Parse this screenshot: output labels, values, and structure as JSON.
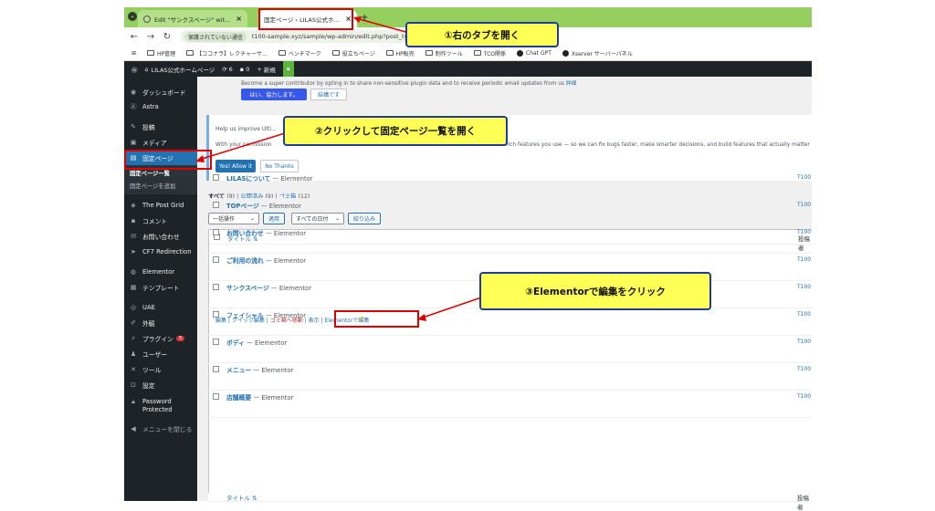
{
  "browser": {
    "tabs": [
      {
        "label": "Edit \"サンクスページ\" with Elemen",
        "active": false
      },
      {
        "label": "固定ページ ‹ LILAS公式ホームページ",
        "active": true
      }
    ],
    "url": "t100-sample.xyz/sample/wp-admin/edit.php?post_type",
    "security_label": "保護されていない通信",
    "bookmarks": [
      "HP管理",
      "【ココナラ】レクチャーサ...",
      "ベンチマーク",
      "役立ちページ",
      "HP販売",
      "制作ツール",
      "TCO関係",
      "Chat GPT",
      "Xserver サーバーパネル"
    ]
  },
  "admin_bar": {
    "site_name": "LILAS公式ホームページ",
    "updates": "6",
    "comments": "0",
    "new_label": "新規"
  },
  "sidebar": {
    "items": [
      {
        "label": "ダッシュボード",
        "icon": "dashboard-icon"
      },
      {
        "label": "Astra",
        "icon": "astra-icon"
      },
      {
        "label": "投稿",
        "icon": "pin-icon"
      },
      {
        "label": "メディア",
        "icon": "media-icon"
      },
      {
        "label": "固定ページ",
        "icon": "pages-icon"
      },
      {
        "label": "The Post Grid",
        "icon": "grid-icon"
      },
      {
        "label": "コメント",
        "icon": "comment-icon"
      },
      {
        "label": "お問い合わせ",
        "icon": "mail-icon"
      },
      {
        "label": "CF7 Redirection",
        "icon": "redirect-icon"
      },
      {
        "label": "Elementor",
        "icon": "elementor-icon"
      },
      {
        "label": "テンプレート",
        "icon": "template-icon"
      },
      {
        "label": "UAE",
        "icon": "uae-icon"
      },
      {
        "label": "外観",
        "icon": "brush-icon"
      },
      {
        "label": "プラグイン",
        "icon": "plugin-icon"
      },
      {
        "label": "ユーザー",
        "icon": "user-icon"
      },
      {
        "label": "ツール",
        "icon": "wrench-icon"
      },
      {
        "label": "設定",
        "icon": "settings-icon"
      },
      {
        "label": "Password Protected",
        "icon": "lock-icon"
      },
      {
        "label": "メニューを閉じる",
        "icon": "collapse-icon"
      }
    ],
    "plugin_badge": "5",
    "submenu": [
      "固定ページ一覧",
      "固定ページを追加"
    ]
  },
  "notices": {
    "top_text": "Become a super contributor by opting in to share non-sensitive plugin data and to receive periodic email updates from us",
    "top_link": "詳細",
    "top_yes": "はい、協力します。",
    "top_no": "結構です",
    "help_title": "Help us improve Ulti...",
    "help_body_left": "With your permission",
    "help_body_right": "nd which features you use — so we can fix bugs faster, make smarter decisions, and build features that actually matter",
    "allow": "Yes! Allow it",
    "no_thanks": "No Thanks"
  },
  "filters": {
    "all": "すべて",
    "all_count": "(9)",
    "published": "公開済み",
    "published_count": "(9)",
    "trash": "ゴミ箱",
    "trash_count": "(12)",
    "bulk_action": "一括操作",
    "apply": "適用",
    "all_dates": "すべての日付",
    "filter": "絞り込み"
  },
  "table": {
    "title_header": "タイトル",
    "author_header": "投稿者",
    "rows": [
      {
        "title": "LILASについて",
        "suffix": "— Elementor",
        "author": "T100"
      },
      {
        "title": "TOPページ",
        "suffix": "— Elementor",
        "author": "T100"
      },
      {
        "title": "お問い合わせ",
        "suffix": "— Elementor",
        "author": "T100"
      },
      {
        "title": "ご利用の流れ",
        "suffix": "— Elementor",
        "author": "T100"
      },
      {
        "title": "サンクスページ",
        "suffix": "— Elementor",
        "author": "T100"
      },
      {
        "title": "フェイシャル",
        "suffix": "— Elementor",
        "author": "T100"
      },
      {
        "title": "ボディ",
        "suffix": "— Elementor",
        "author": "T100"
      },
      {
        "title": "メニュー",
        "suffix": "— Elementor",
        "author": "T100"
      },
      {
        "title": "店舗概要",
        "suffix": "— Elementor",
        "author": "T100"
      }
    ],
    "row_actions": {
      "edit": "編集",
      "quick_edit": "クイック編集",
      "trash": "ゴミ箱へ移動",
      "view": "表示",
      "elementor": "Elementorで編集"
    }
  },
  "annotations": {
    "step1": "①右のタブを開く",
    "step2": "②クリックして固定ページ一覧を開く",
    "step3": "③Elementorで編集をクリック"
  },
  "colors": {
    "accent": "#2271b1",
    "admin_dark": "#1d2327",
    "callout_fill": "#ffff55",
    "callout_border": "#1f3ba0",
    "highlight_red": "#e00000",
    "tab_strip": "#95d05e"
  }
}
